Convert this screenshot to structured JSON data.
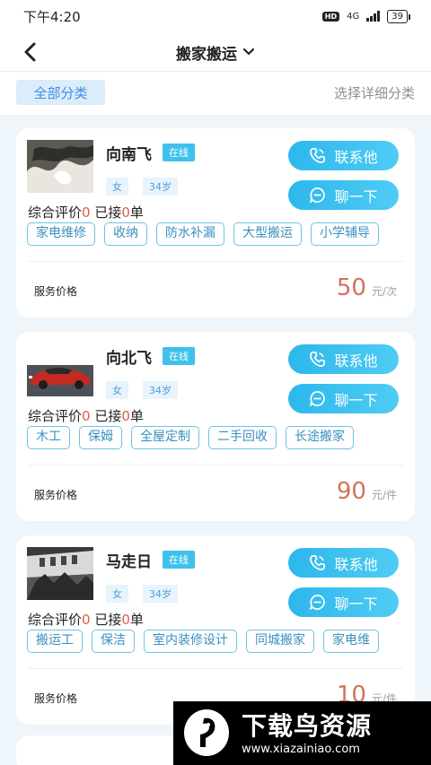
{
  "status": {
    "time": "下午4:20",
    "hd": "HD",
    "network": "4G",
    "battery": "39"
  },
  "nav": {
    "title": "搬家搬运"
  },
  "filter": {
    "all_label": "全部分类",
    "detail_label": "选择详细分类"
  },
  "labels": {
    "call": "联系他",
    "chat": "聊一下",
    "rating": "综合评价",
    "taken_prefix": "已接",
    "taken_suffix": "单",
    "price_label": "服务价格"
  },
  "providers": [
    {
      "name": "向南飞",
      "online": "在线",
      "sex": "女",
      "age": "34岁",
      "rating": "0",
      "taken": "0",
      "skills": [
        "家电维修",
        "收纳",
        "防水补漏",
        "大型搬运",
        "小学辅导"
      ],
      "price": "50",
      "unit": "元/次"
    },
    {
      "name": "向北飞",
      "online": "在线",
      "sex": "女",
      "age": "34岁",
      "rating": "0",
      "taken": "0",
      "skills": [
        "木工",
        "保姆",
        "全屋定制",
        "二手回收",
        "长途搬家"
      ],
      "price": "90",
      "unit": "元/件"
    },
    {
      "name": "马走日",
      "online": "在线",
      "sex": "女",
      "age": "34岁",
      "rating": "0",
      "taken": "0",
      "skills": [
        "搬运工",
        "保洁",
        "室内装修设计",
        "同城搬家",
        "家电维"
      ],
      "price": "10",
      "unit": "元/件"
    }
  ],
  "watermark": {
    "title": "下载鸟资源",
    "url": "www.xiazainiao.com"
  },
  "colors": {
    "accent": "#3ec1ec",
    "price": "#d2735a",
    "rating_red": "#e35b4a"
  }
}
